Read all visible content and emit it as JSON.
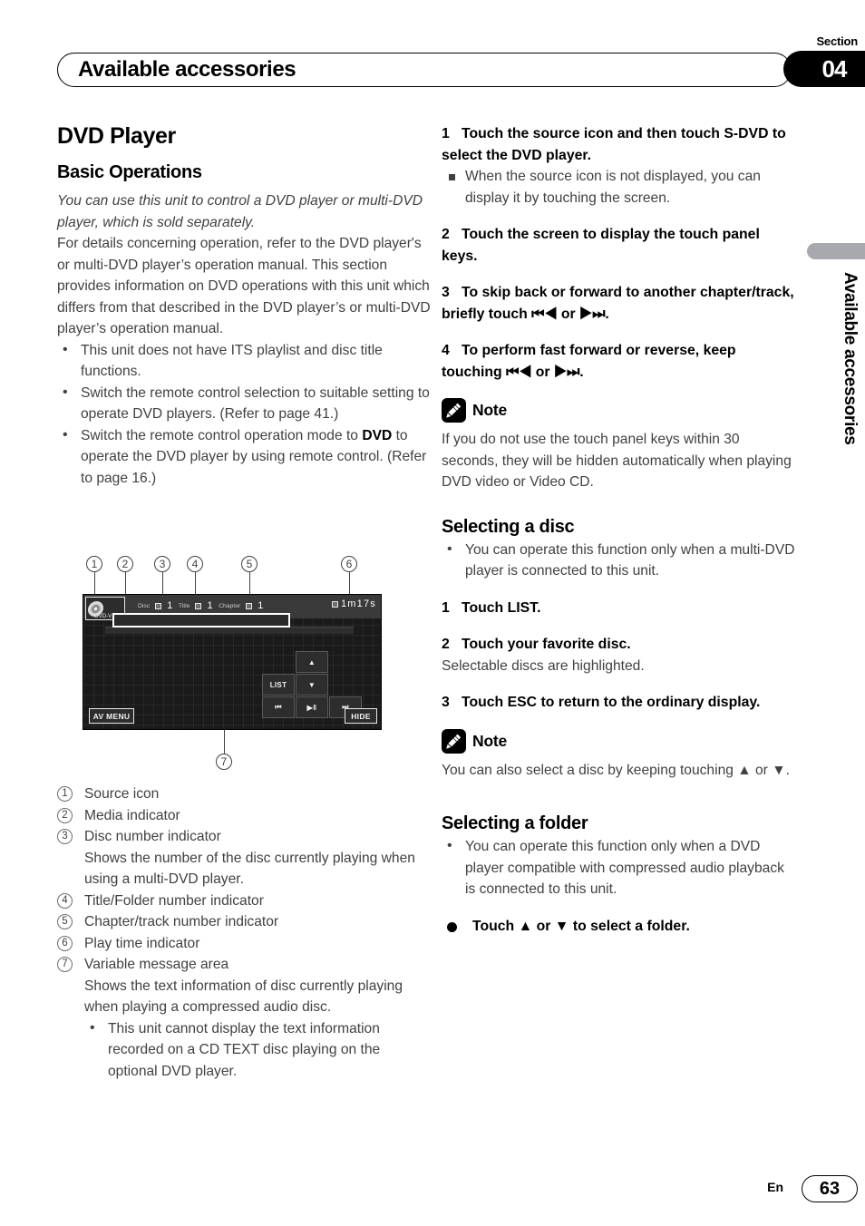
{
  "header": {
    "section_word": "Section",
    "section_number": "04",
    "title": "Available accessories"
  },
  "side_tab": {
    "label": "Available accessories"
  },
  "left_column": {
    "h1": "DVD Player",
    "h2": "Basic Operations",
    "intro_italic": "You can use this unit to control a DVD player or multi-DVD player, which is sold separately.",
    "intro_body": "For details concerning operation, refer to the DVD player's or multi-DVD player’s operation manual. This section provides information on DVD operations with this unit which differs from that described in the DVD player’s or multi-DVD player’s operation manual.",
    "bullets": [
      "This unit does not have ITS playlist and disc title functions.",
      "Switch the remote control selection to suitable setting to operate DVD players. (Refer to page 41.)"
    ],
    "bullet3_pre": "Switch the remote control operation mode to ",
    "bullet3_bold": "DVD",
    "bullet3_post": " to operate the DVD player by using remote control. (Refer to page 16.)",
    "legend": [
      {
        "num": "1",
        "label": "Source icon",
        "detail": ""
      },
      {
        "num": "2",
        "label": "Media indicator",
        "detail": ""
      },
      {
        "num": "3",
        "label": "Disc number indicator",
        "detail": "Shows the number of the disc currently playing when using a multi-DVD player."
      },
      {
        "num": "4",
        "label": "Title/Folder number indicator",
        "detail": ""
      },
      {
        "num": "5",
        "label": "Chapter/track number indicator",
        "detail": ""
      },
      {
        "num": "6",
        "label": "Play time indicator",
        "detail": ""
      },
      {
        "num": "7",
        "label": "Variable message area",
        "detail": "Shows the text information of disc currently playing when playing a compressed audio disc.",
        "subbullet": "This unit cannot display the text information recorded on a CD TEXT disc playing on the optional DVD player."
      }
    ]
  },
  "figure": {
    "callouts": [
      "1",
      "2",
      "3",
      "4",
      "5",
      "6",
      "7"
    ],
    "screen": {
      "media_indicator": "DVD-V",
      "disc_label": "Disc",
      "disc_value": "1",
      "title_label": "Title",
      "title_value": "1",
      "chapter_label": "Chapter",
      "chapter_value": "1",
      "play_time": "1m17s",
      "keys": {
        "up": "▲",
        "down": "▼",
        "list": "LIST",
        "prev": "⏮",
        "play_pause": "▶‖",
        "next": "⏭",
        "av_menu": "AV MENU",
        "hide": "HIDE"
      }
    }
  },
  "right_column": {
    "steps": [
      {
        "num": "1",
        "text": "Touch the source icon and then touch S-DVD to select the DVD player."
      },
      {
        "num": "2",
        "text": "Touch the screen to display the touch panel keys."
      },
      {
        "num": "3",
        "text": "To skip back or forward to another chapter/track, briefly touch ⏮◀ or ▶⏭."
      },
      {
        "num": "4",
        "text": "To perform fast forward or reverse, keep touching ⏮◀ or ▶⏭."
      }
    ],
    "step1_square_note": "When the source icon is not displayed, you can display it by touching the screen.",
    "note1": {
      "label": "Note",
      "text": "If you do not use the touch panel keys within 30 seconds, they will be hidden automatically when playing DVD video or Video CD."
    },
    "selecting_disc": {
      "heading": "Selecting a disc",
      "bullet": "You can operate this function only when a multi-DVD player is connected to this unit.",
      "steps": [
        {
          "num": "1",
          "text": "Touch LIST.",
          "after": ""
        },
        {
          "num": "2",
          "text": "Touch your favorite disc.",
          "after": "Selectable discs are highlighted."
        },
        {
          "num": "3",
          "text": "Touch ESC to return to the ordinary display.",
          "after": ""
        }
      ]
    },
    "note2": {
      "label": "Note",
      "text": "You can also select a disc by keeping touching ▲ or ▼."
    },
    "selecting_folder": {
      "heading": "Selecting a folder",
      "bullet": "You can operate this function only when a DVD player compatible with compressed audio playback is connected to this unit.",
      "action": "Touch ▲ or ▼ to select a folder."
    }
  },
  "footer": {
    "lang": "En",
    "page": "63"
  }
}
